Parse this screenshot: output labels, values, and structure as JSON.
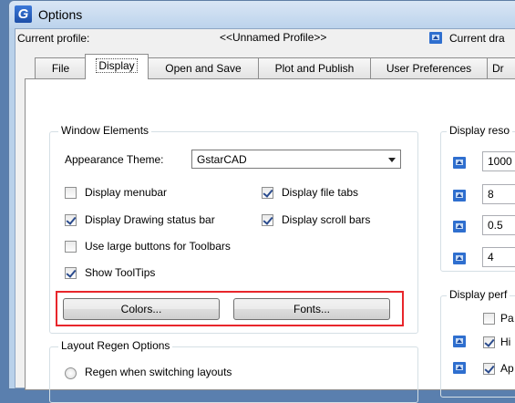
{
  "window": {
    "title": "Options",
    "app_icon_letter": "G"
  },
  "profile": {
    "current_profile_label": "Current profile:",
    "profile_name": "<<Unnamed Profile>>",
    "current_drawing_label": "Current dra"
  },
  "tabs": [
    {
      "label": "File"
    },
    {
      "label": "Display",
      "active": true
    },
    {
      "label": "Open and Save"
    },
    {
      "label": "Plot and Publish"
    },
    {
      "label": "User Preferences"
    },
    {
      "label": "Dr"
    }
  ],
  "window_elements": {
    "title": "Window Elements",
    "appearance_theme_label": "Appearance Theme:",
    "appearance_theme_value": "GstarCAD",
    "checkboxes": [
      {
        "label": "Display menubar",
        "checked": false
      },
      {
        "label": "Display file tabs",
        "checked": true
      },
      {
        "label": "Display Drawing status bar",
        "checked": true
      },
      {
        "label": "Display scroll bars",
        "checked": true
      },
      {
        "label": "Use large buttons for Toolbars",
        "checked": false
      },
      {
        "label": "Show ToolTips",
        "checked": true
      }
    ],
    "colors_button": "Colors...",
    "fonts_button": "Fonts..."
  },
  "layout_regen": {
    "title": "Layout Regen Options",
    "option_1": "Regen when switching layouts"
  },
  "display_resolution": {
    "title": "Display reso",
    "values": [
      "1000",
      "8",
      "0.5",
      "4"
    ]
  },
  "display_performance": {
    "title": "Display perf",
    "items": [
      {
        "label": "Pa",
        "checked": false
      },
      {
        "label": "Hi",
        "checked": true
      },
      {
        "label": "Ap",
        "checked": true
      }
    ]
  },
  "colors": {
    "title_bar": "#c7daf0",
    "highlight_box": "#e8262b",
    "accent_icon": "#2f6fcf"
  }
}
